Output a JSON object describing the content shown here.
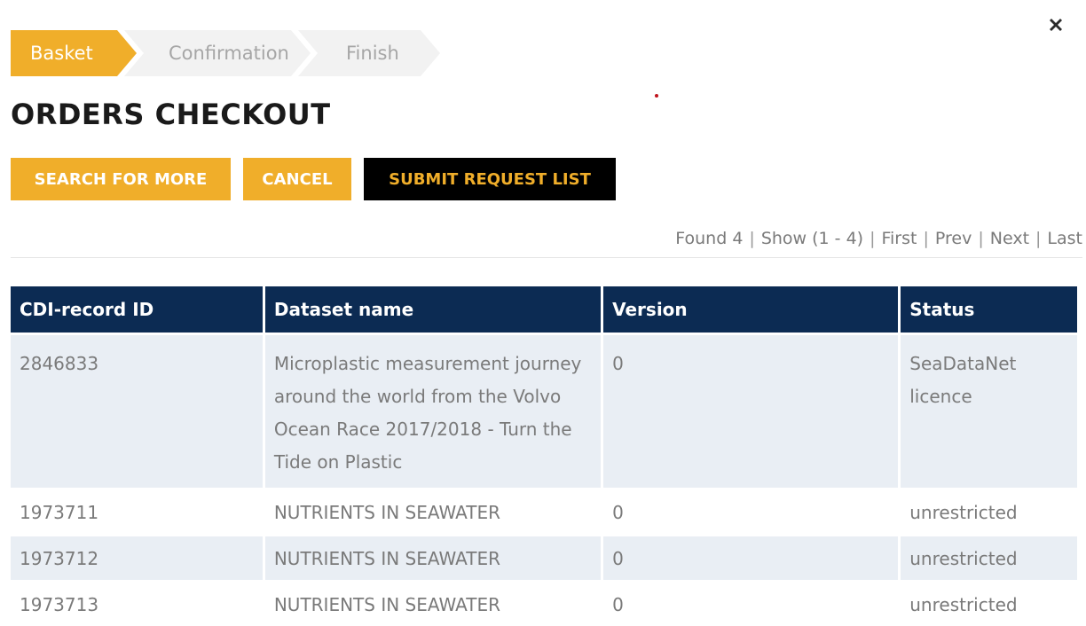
{
  "steps": [
    {
      "label": "Basket",
      "active": true
    },
    {
      "label": "Confirmation",
      "active": false
    },
    {
      "label": "Finish",
      "active": false
    }
  ],
  "page_title": "ORDERS CHECKOUT",
  "buttons": {
    "search": "SEARCH FOR MORE",
    "cancel": "CANCEL",
    "submit": "SUBMIT REQUEST LIST"
  },
  "pager": {
    "found": "Found 4",
    "show": "Show (1 - 4)",
    "first": "First",
    "prev": "Prev",
    "next": "Next",
    "last": "Last"
  },
  "table": {
    "headers": [
      "CDI-record ID",
      "Dataset name",
      "Version",
      "Status"
    ],
    "rows": [
      {
        "id": "2846833",
        "name": "Microplastic measurement journey around the world from the Volvo Ocean Race 2017/2018 - Turn the Tide on Plastic",
        "version": "0",
        "status": "SeaDataNet licence"
      },
      {
        "id": "1973711",
        "name": "NUTRIENTS IN SEAWATER",
        "version": "0",
        "status": "unrestricted"
      },
      {
        "id": "1973712",
        "name": "NUTRIENTS IN SEAWATER",
        "version": "0",
        "status": "unrestricted"
      },
      {
        "id": "1973713",
        "name": "NUTRIENTS IN SEAWATER",
        "version": "0",
        "status": "unrestricted"
      }
    ]
  },
  "colors": {
    "accent": "#f0ae2a",
    "header_bg": "#0c2b53",
    "row_alt": "#e9eef4",
    "submit_bg": "#000000"
  },
  "icons": {
    "close": "close-icon"
  }
}
